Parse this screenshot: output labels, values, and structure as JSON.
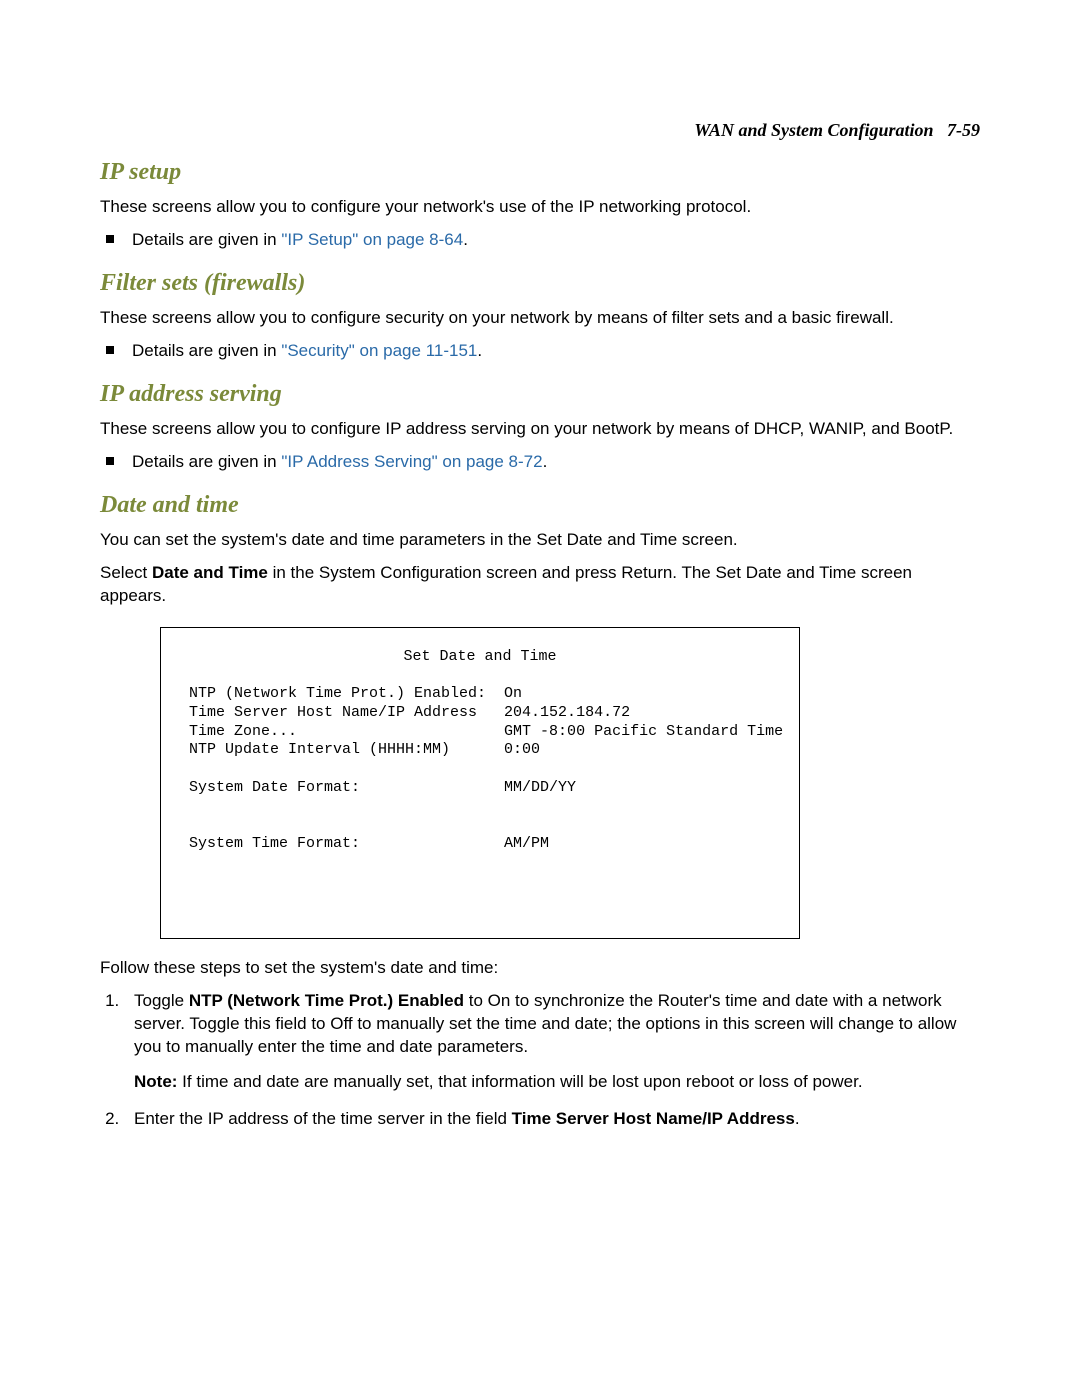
{
  "header": {
    "title": "WAN and System Configuration",
    "page_ref": "7-59"
  },
  "sections": {
    "ip_setup": {
      "heading": "IP setup",
      "desc": "These screens allow you to configure your network's use of the IP networking protocol.",
      "bullet_prefix": "Details are given in ",
      "link_text": "\"IP Setup\" on page 8-64",
      "bullet_suffix": "."
    },
    "filter_sets": {
      "heading": "Filter sets (firewalls)",
      "desc": "These screens allow you to configure security on your network by means of filter sets and a basic firewall.",
      "bullet_prefix": "Details are given in ",
      "link_text": "\"Security\" on page 11-151",
      "bullet_suffix": "."
    },
    "ip_addr": {
      "heading": "IP address serving",
      "desc": "These screens allow you to configure IP address serving on your network by means of DHCP, WANIP, and BootP.",
      "bullet_prefix": "Details are given in ",
      "link_text": "\"IP Address Serving\" on page 8-72",
      "bullet_suffix": "."
    },
    "date_time": {
      "heading": "Date and time",
      "desc1": "You can set the system's date and time parameters in the Set Date and Time screen.",
      "desc2_pre": "Select ",
      "desc2_bold": "Date and Time",
      "desc2_post": " in the System Configuration screen and press Return. The Set Date and Time screen appears."
    }
  },
  "terminal": {
    "title": "Set Date and Time",
    "rows": [
      {
        "label": "NTP (Network Time Prot.) Enabled:",
        "value": "On"
      },
      {
        "label": "Time Server Host Name/IP Address",
        "value": "204.152.184.72"
      },
      {
        "label": "Time Zone...",
        "value": "GMT -8:00 Pacific Standard Time"
      },
      {
        "label": "NTP Update Interval (HHHH:MM)",
        "value": "0:00"
      },
      {
        "label": "",
        "value": ""
      },
      {
        "label": "System Date Format:",
        "value": "MM/DD/YY"
      },
      {
        "label": "",
        "value": ""
      },
      {
        "label": "",
        "value": ""
      },
      {
        "label": "System Time Format:",
        "value": "AM/PM"
      }
    ]
  },
  "post_terminal": {
    "intro": "Follow these steps to set the system's date and time:",
    "step1_pre": "Toggle ",
    "step1_bold": "NTP (Network Time Prot.) Enabled",
    "step1_post": " to On to synchronize the Router's time and date with a network server.  Toggle this field to Off to manually set the time and date; the options in this screen will change to allow you to manually enter the time and date parameters.",
    "note_label": "Note:",
    "note_text": "  If time and date are manually set, that information will be lost upon reboot or loss of power.",
    "step2_pre": "Enter the IP address of the time server in the field ",
    "step2_bold": "Time Server Host Name/IP Address",
    "step2_post": "."
  }
}
